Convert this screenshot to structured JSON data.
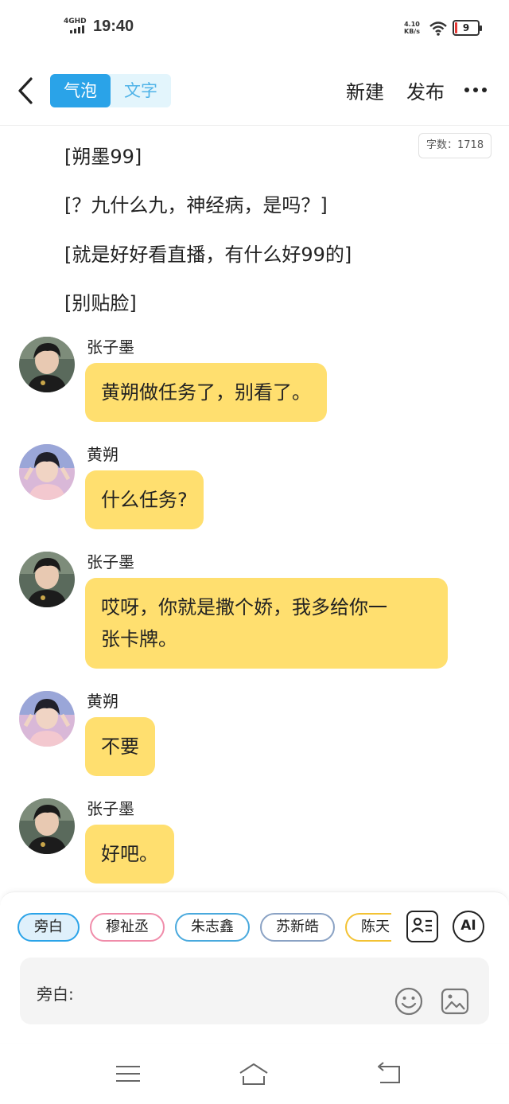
{
  "status_bar": {
    "network": "4GHD",
    "time": "19:40",
    "speed_value": "4.10",
    "speed_unit": "KB/s",
    "battery": "9",
    "battery_color": "#e53935"
  },
  "header": {
    "tabs": [
      {
        "label": "气泡",
        "active": true
      },
      {
        "label": "文字",
        "active": false
      }
    ],
    "new_label": "新建",
    "publish_label": "发布",
    "back_icon": "chevron-left-icon",
    "more_icon": "more-horizontal-icon"
  },
  "word_count": "字数：1718",
  "narration": [
    "[朔墨99]",
    "[？九什么九，神经病，是吗？]",
    "[就是好好看直播，有什么好99的]",
    "[别贴脸]"
  ],
  "messages": [
    {
      "speaker": "张子墨",
      "lines": [
        "黄朔做任务了，别看了。"
      ]
    },
    {
      "speaker": "黄朔",
      "lines": [
        "什么任务?"
      ]
    },
    {
      "speaker": "张子墨",
      "lines": [
        "哎呀，你就是撒个娇，我多给你一",
        "张卡牌。"
      ]
    },
    {
      "speaker": "黄朔",
      "lines": [
        "不要"
      ]
    },
    {
      "speaker": "张子墨",
      "lines": [
        "好吧。"
      ]
    }
  ],
  "characters": [
    "旁白",
    "穆祉丞",
    "朱志鑫",
    "苏新皓",
    "陈天"
  ],
  "ai_label": "AI",
  "input": {
    "label": "旁白:",
    "value": "",
    "placeholder": ""
  },
  "colors": {
    "accent": "#2aa3e8",
    "bubble": "#ffdf6f"
  }
}
